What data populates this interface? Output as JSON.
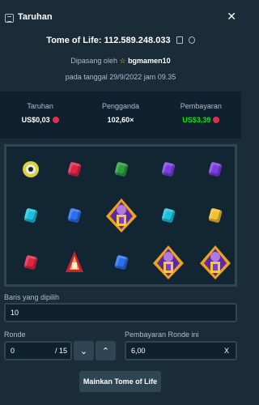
{
  "header": {
    "title": "Taruhan",
    "close_icon": "close-icon"
  },
  "bet": {
    "game": "Tome of Life",
    "id": "112.589.248.033",
    "label": "Tome of Life: 112.589.248.033"
  },
  "placed_by": {
    "prefix": "Dipasang oleh",
    "user": "bgmamen10"
  },
  "date": "pada tanggal 29/9/2022 jam 09.35",
  "stats": [
    {
      "label": "Taruhan",
      "value": "US$0,03"
    },
    {
      "label": "Pengganda",
      "value": "102,60×"
    },
    {
      "label": "Pembayaran",
      "value": "US$3,39"
    }
  ],
  "colors": {
    "payout": "#00e701",
    "coin": "#e22d4c",
    "panel": "#0f212e",
    "bg": "#1a2c38"
  },
  "board": {
    "columns": 5,
    "rows": 3,
    "symbols": [
      [
        "eye",
        "red-gem",
        "green-gem",
        "purple-gem",
        "purple-gem"
      ],
      [
        "cyan-gem",
        "blue-gem",
        "pharaoh",
        "cyan-gem",
        "yellow-gem"
      ],
      [
        "red-gem",
        "red-relic",
        "blue-gem",
        "pharaoh",
        "pharaoh"
      ]
    ]
  },
  "lines": {
    "label": "Baris yang dipilih",
    "value": "10"
  },
  "rounds": {
    "label": "Ronde",
    "value": "0",
    "suffix": "/ 15"
  },
  "round_payout": {
    "label": "Pembayaran Ronde ini",
    "value": "6,00",
    "icon": "x-icon"
  },
  "play_button": "Mainkan Tome of Life"
}
